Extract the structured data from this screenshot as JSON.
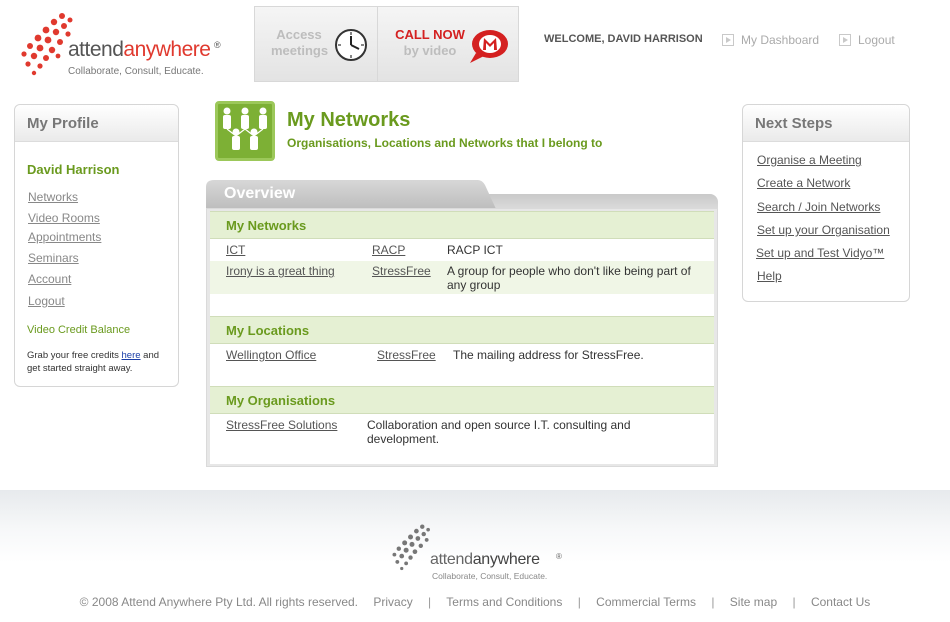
{
  "header": {
    "logo": {
      "word_a": "attend",
      "word_b": "anywhere",
      "reg": "®",
      "tagline": "Collaborate, Consult, Educate."
    },
    "access": {
      "line1": "Access",
      "line2": "meetings"
    },
    "call": {
      "line1": "CALL NOW",
      "line2": "by video"
    },
    "welcome": "WELCOME, DAVID HARRISON",
    "dashboard": "My Dashboard",
    "logout": "Logout"
  },
  "profile": {
    "title": "My Profile",
    "name": "David Harrison",
    "nav": [
      "Networks",
      "Video Rooms",
      "Appointments",
      "Seminars",
      "Account",
      "Logout"
    ],
    "credit_label": "Video Credit Balance",
    "grab_prefix": "Grab your free credits ",
    "grab_link": "here",
    "grab_suffix": " and get started straight away."
  },
  "page": {
    "title": "My Networks",
    "subtitle": "Organisations, Locations and Networks that I belong to",
    "tab": "Overview"
  },
  "sections": {
    "networks": {
      "title": "My Networks",
      "rows": [
        {
          "name": "ICT",
          "org": "RACP",
          "desc": "RACP ICT"
        },
        {
          "name": "Irony is a great thing",
          "org": "StressFree",
          "desc": "A group for people who don't like being part of any group"
        }
      ]
    },
    "locations": {
      "title": "My Locations",
      "rows": [
        {
          "name": "Wellington Office",
          "org": "StressFree",
          "desc": "The mailing address for StressFree."
        }
      ]
    },
    "organisations": {
      "title": "My Organisations",
      "rows": [
        {
          "name": "StressFree Solutions",
          "desc": "Collaboration and open source I.T. consulting and development."
        }
      ]
    }
  },
  "next_steps": {
    "title": "Next Steps",
    "links": [
      "Organise a Meeting",
      "Create a Network",
      "Search / Join Networks",
      "Set up your Organisation",
      "Set up and Test Vidyo™",
      "Help"
    ]
  },
  "footer": {
    "copyright": "© 2008 Attend Anywhere Pty Ltd. All rights reserved.",
    "links": [
      "Privacy",
      "Terms and Conditions",
      "Commercial Terms",
      "Site map",
      "Contact Us"
    ]
  },
  "colors": {
    "accent_green": "#6a9a1e",
    "accent_red": "#e0392e",
    "section_bg": "#e5f0d3"
  }
}
